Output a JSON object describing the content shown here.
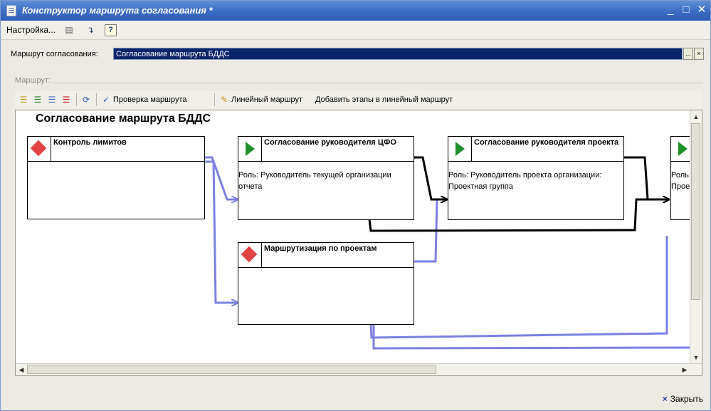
{
  "window": {
    "title": "Конструктор маршрута согласования *",
    "controls": {
      "minimize": "_",
      "maximize": "□",
      "close": "✕"
    }
  },
  "menubar": {
    "settings_label": "Настройка...",
    "help_label": "?"
  },
  "route_field": {
    "label": "Маршрут согласования:",
    "value": "Согласование маршрута БДДС",
    "select_button": "...",
    "clear_button": "×"
  },
  "section": {
    "label": "Маршрут:"
  },
  "diagram_toolbar": {
    "check_route_label": "Проверка маршрута",
    "linear_route_label": "Линейный маршрут",
    "add_stages_label": "Добавить этапы в линейный маршрут"
  },
  "diagram": {
    "title": "Согласование маршрута БДДС",
    "nodes": [
      {
        "title": "Контроль лимитов",
        "role": "",
        "icon": "red-diamond-icon"
      },
      {
        "title": "Согласование руководителя ЦФО",
        "role": "Роль: Руководитель текущей организации отчета",
        "icon": "green-play-icon"
      },
      {
        "title": "Согласование руководителя проекта",
        "role": "Роль: Руководитель проекта организации: Проектная группа",
        "icon": "green-play-icon"
      },
      {
        "title": "",
        "role": "Роль: Прое",
        "icon": "green-play-icon"
      },
      {
        "title": "Маршрутизация по проектам",
        "role": "",
        "icon": "red-diamond-icon"
      }
    ],
    "colors": {
      "connector_black": "#000000",
      "connector_blue": "#7b80e0",
      "diamond": "#e14444",
      "play": "#1e8f2a"
    }
  },
  "bottom": {
    "close_label": "Закрыть",
    "close_icon": "×"
  },
  "colors": {
    "titlebar": "#3a6cc3",
    "selected_field": "#0a246a"
  }
}
